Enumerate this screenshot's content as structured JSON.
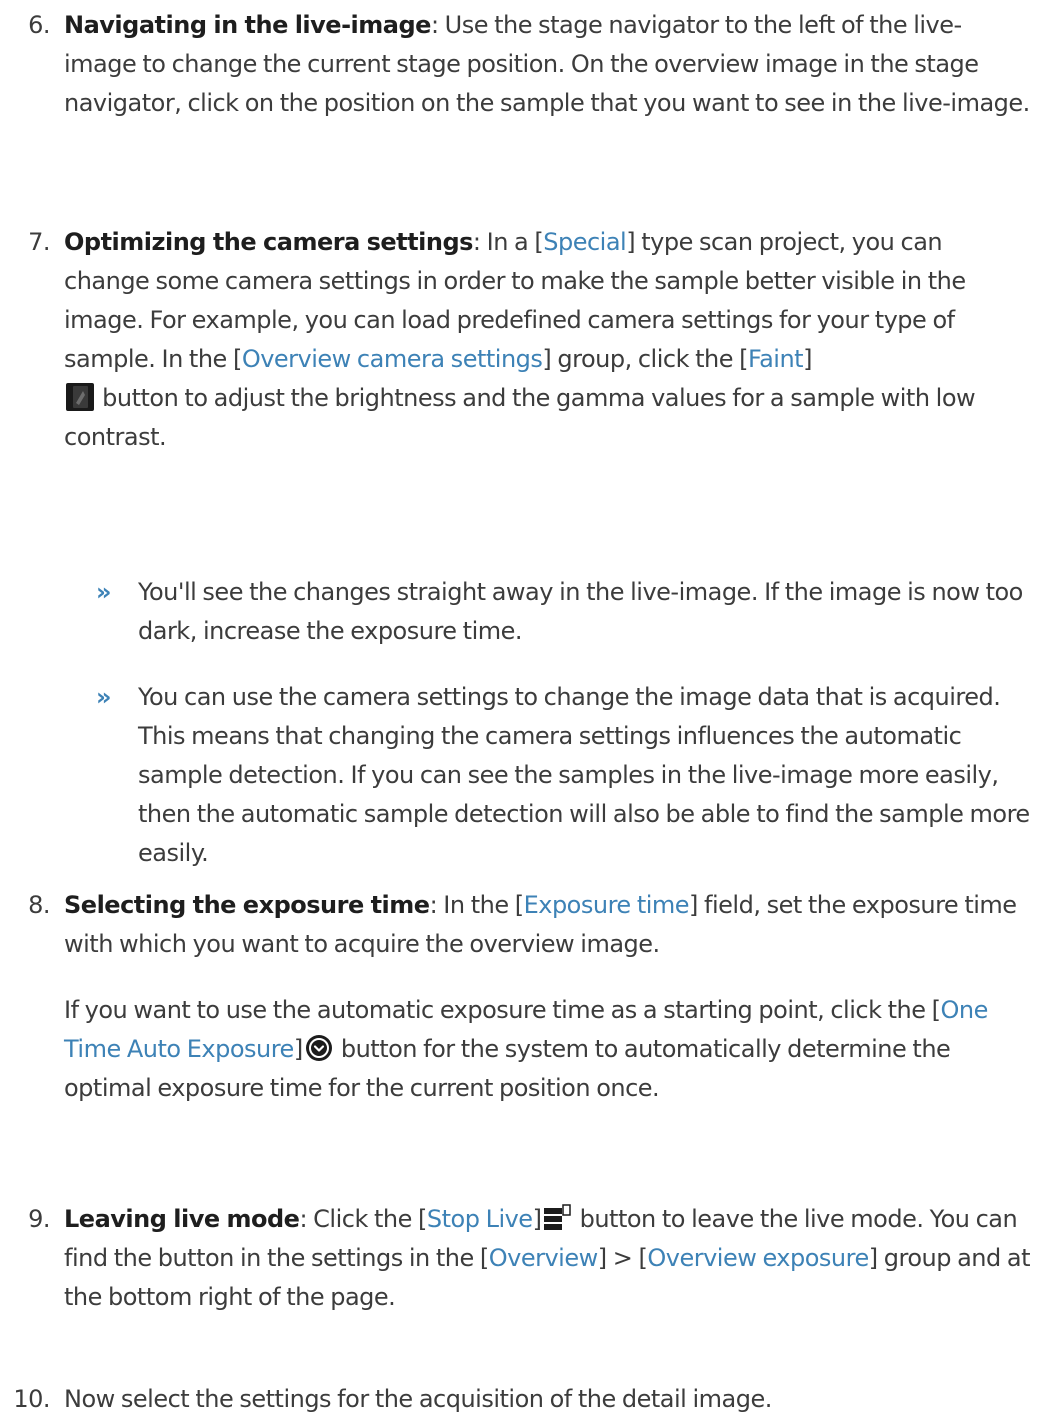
{
  "steps": [
    {
      "number": "6.",
      "title": "Navigating in the live-image",
      "text": ": Use the stage navigator to the left of the live-image to change the current stage position. On the overview image in the stage navigator, click on the position on the sample that you want to see in the live-image."
    },
    {
      "number": "7.",
      "title": "Optimizing the camera settings",
      "t1": ": In a [",
      "ui1": "Special",
      "t2": "] type scan project, you can change some camera settings in order to make the sample better visible in the image. For example, you can load predefined camera settings for your type of sample. In the [",
      "ui2": "Overview camera settings",
      "t3": "] group, click the [",
      "ui3": "Faint",
      "t4": "]",
      "icon": "faint-icon",
      "t5": " button to adjust the brightness and the gamma values for a sample with low contrast.",
      "bullets": [
        "You'll see the changes straight away in the live-image. If the image is now too dark, increase the exposure time.",
        "You can use the camera settings to change the image data that is acquired. This means that changing the camera settings influences the automatic sample detection. If you can see the samples in the live-image more easily, then the automatic sample detection will also be able to find the sample more easily."
      ],
      "bullet_glyph": "»"
    },
    {
      "number": "8.",
      "title": "Selecting the exposure time",
      "t1": ": In the [",
      "ui1": "Exposure time",
      "t2": "] field, set the exposure time with which you want to acquire the overview image.",
      "p2_t1": "If you want to use the automatic exposure time as a starting point, click the [",
      "p2_ui1": "One Time Auto Exposure",
      "p2_t2": "]",
      "icon": "auto-exposure-icon",
      "p2_t3": " button for the system to automatically determine the optimal exposure time for the current position once."
    },
    {
      "number": "9.",
      "title": "Leaving live mode",
      "t1": ": Click the [",
      "ui1": "Stop Live",
      "t2": "]",
      "icon": "stop-live-icon",
      "t3": " button to leave the live mode. You can find the button in the settings in the [",
      "ui2": "Overview",
      "t4": "] > [",
      "ui3": "Overview exposure",
      "t5": "] group and at the bottom right of the page."
    },
    {
      "number": "10.",
      "text": "Now select the settings for the acquisition of the detail image."
    }
  ],
  "colors": {
    "text": "#3c3c3c",
    "ui_reference": "#3d82b6",
    "bold": "#1e1e1e"
  }
}
